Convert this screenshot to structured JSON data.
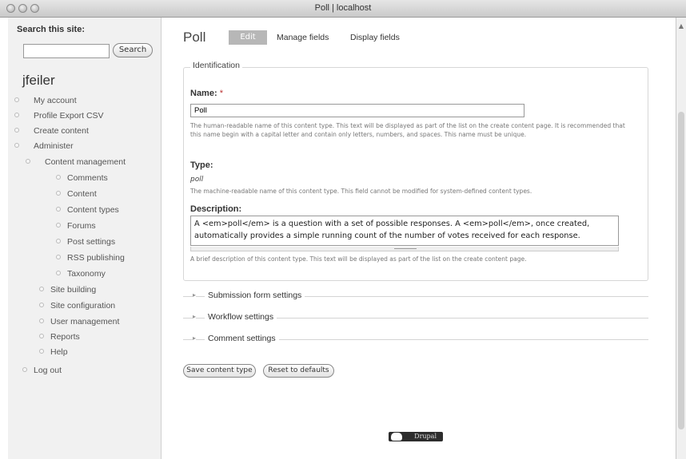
{
  "window": {
    "title": "Poll | localhost"
  },
  "sidebar": {
    "search_label": "Search this site:",
    "search_value": "",
    "search_button": "Search",
    "username": "jfeiler",
    "items": [
      {
        "label": "My account"
      },
      {
        "label": "Profile Export CSV"
      },
      {
        "label": "Create content"
      },
      {
        "label": "Administer"
      },
      {
        "label": "Content management"
      },
      {
        "label": "Comments"
      },
      {
        "label": "Content"
      },
      {
        "label": "Content types"
      },
      {
        "label": "Forums"
      },
      {
        "label": "Post settings"
      },
      {
        "label": "RSS publishing"
      },
      {
        "label": "Taxonomy"
      },
      {
        "label": "Site building"
      },
      {
        "label": "Site configuration"
      },
      {
        "label": "User management"
      },
      {
        "label": "Reports"
      },
      {
        "label": "Help"
      },
      {
        "label": "Log out"
      }
    ]
  },
  "main": {
    "title": "Poll",
    "tabs": {
      "edit": "Edit",
      "manage_fields": "Manage fields",
      "display_fields": "Display fields"
    },
    "fieldset_legend": "Identification",
    "name": {
      "label": "Name:",
      "required_marker": "*",
      "value": "Poll",
      "help": "The human-readable name of this content type. This text will be displayed as part of the list on the create content page. It is recommended that this name begin with a capital letter and contain only letters, numbers, and spaces. This name must be unique."
    },
    "type": {
      "label": "Type:",
      "value": "poll",
      "help": "The machine-readable name of this content type. This field cannot be modified for system-defined content types."
    },
    "description": {
      "label": "Description:",
      "value": "A <em>poll</em> is a question with a set of possible responses. A <em>poll</em>, once created, automatically provides a simple running count of the number of votes received for each response.",
      "help": "A brief description of this content type. This text will be displayed as part of the list on the create content page."
    },
    "collapsed_sections": {
      "submission": "Submission form settings",
      "workflow": "Workflow settings",
      "comment": "Comment settings"
    },
    "buttons": {
      "save": "Save content type",
      "reset": "Reset to defaults"
    },
    "footer_badge": "Drupal"
  }
}
